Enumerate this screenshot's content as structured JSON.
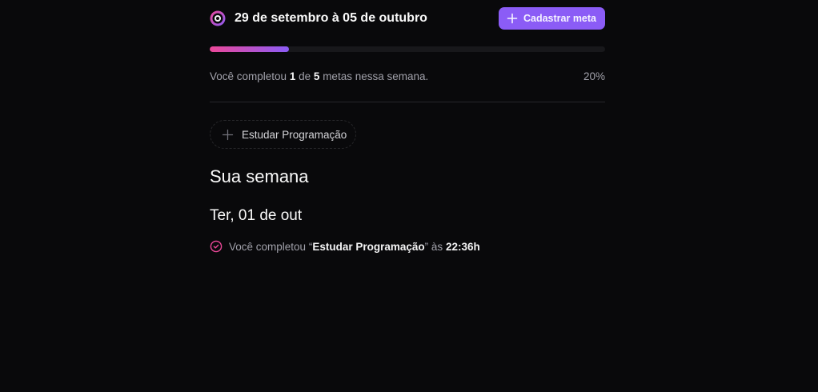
{
  "header": {
    "week_range": "29 de setembro à 05 de outubro",
    "logo_icon": "target-logo-icon",
    "add_goal_button": {
      "label": "Cadastrar meta",
      "icon": "plus-icon"
    }
  },
  "progress": {
    "completed": "1",
    "total": "5",
    "text_prefix": "Você completou",
    "text_middle": "de",
    "text_suffix": "metas nessa semana.",
    "percent_label": "20%",
    "fraction": 0.2,
    "gradient_start": "#ec4899",
    "gradient_end": "#8b5cf6"
  },
  "pending_goals": [
    {
      "label": "Estudar Programação",
      "icon": "plus-icon"
    }
  ],
  "summary": {
    "title": "Sua semana",
    "days": [
      {
        "title": "Ter, 01 de out",
        "items": [
          {
            "icon": "check-circle-icon",
            "prefix": "Você completou",
            "open_quote": "“",
            "goal": "Estudar Programação",
            "close_quote": "”",
            "connector": "às",
            "time": "22:36h"
          }
        ]
      }
    ]
  },
  "colors": {
    "background": "#09090b",
    "accent": "#8b5cf6",
    "pink": "#ec4899"
  }
}
